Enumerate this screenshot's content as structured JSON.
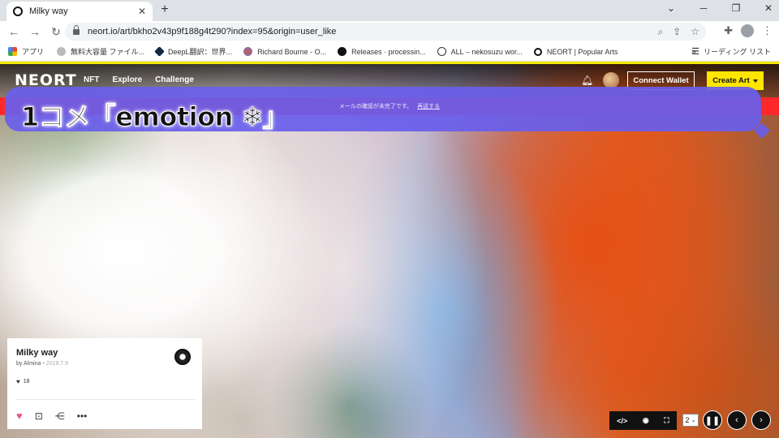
{
  "browser": {
    "tab_title": "Milky way",
    "url": "neort.io/art/bkho2v43p9f188g4t290?index=95&origin=user_like",
    "bookmarks": [
      {
        "label": "アプリ",
        "color": "#ea4335"
      },
      {
        "label": "無料大容量 ファイル...",
        "color": "#b0b0b0"
      },
      {
        "label": "DeepL翻訳：世界...",
        "color": "#0f2b46"
      },
      {
        "label": "Richard Bourne - O...",
        "color": "#d9534f"
      },
      {
        "label": "Releases · processin...",
        "color": "#111111"
      },
      {
        "label": "ALL – nekosuzu wor...",
        "color": "#333333"
      },
      {
        "label": "NEORT | Popular Arts",
        "color": "#111111"
      }
    ],
    "bookmarks_more": "»",
    "reading_list": "リーディング リスト"
  },
  "site": {
    "logo": "NEORT",
    "nav": [
      "NFT",
      "Explore",
      "Challenge"
    ],
    "connect_wallet": "Connect Wallet",
    "create_art": "Create Art",
    "banner_text": "メールの確認が未完了です。",
    "banner_link": "再送する"
  },
  "overlay": {
    "caption": "1コメ「emotion ❄」"
  },
  "artwork": {
    "title": "Milky way",
    "author_prefix": "by",
    "author": "Almina",
    "date": "2019.7.9",
    "likes": "18"
  },
  "controls": {
    "code": "</>",
    "speed": "2"
  },
  "colors": {
    "accent_yellow": "#ffe600",
    "banner_red": "#ff2828",
    "heart_pink": "#e85a7a"
  }
}
